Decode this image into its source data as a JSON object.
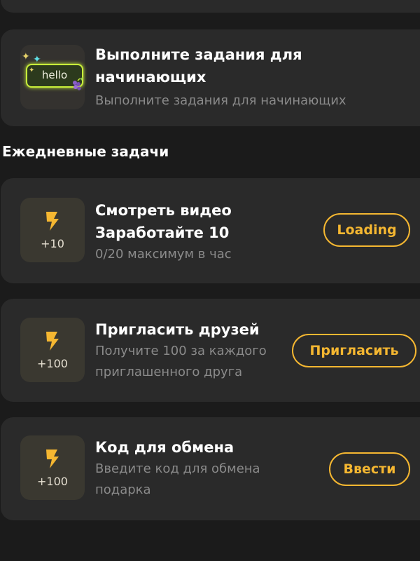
{
  "beginner": {
    "title_line1": "Выполните задания для",
    "title_line2": "начинающих",
    "subtitle": "Выполните задания для начинающих",
    "badge_text": "hello"
  },
  "daily": {
    "section_title": "Ежедневные задачи",
    "tasks": [
      {
        "title_line1": "Смотреть видео",
        "title_line2": "Заработайте 10",
        "sub_line1": "0/20 максимум в час",
        "reward": "+10",
        "button": "Loading",
        "icon": "lightning-icon"
      },
      {
        "title_line1": "Пригласить друзей",
        "sub_line1": "Получите 100 за каждого",
        "sub_line2": "приглашенного друга",
        "reward": "+100",
        "button": "Пригласить",
        "icon": "lightning-icon"
      },
      {
        "title_line1": "Код для обмена",
        "sub_line1": "Введите код для обмена",
        "sub_line2": "подарка",
        "reward": "+100",
        "button": "Ввести",
        "icon": "lightning-icon"
      }
    ]
  },
  "colors": {
    "background": "#1b1b1b",
    "card": "#2a2a2a",
    "accent": "#f5b731",
    "muted_text": "#8a8a8a"
  }
}
